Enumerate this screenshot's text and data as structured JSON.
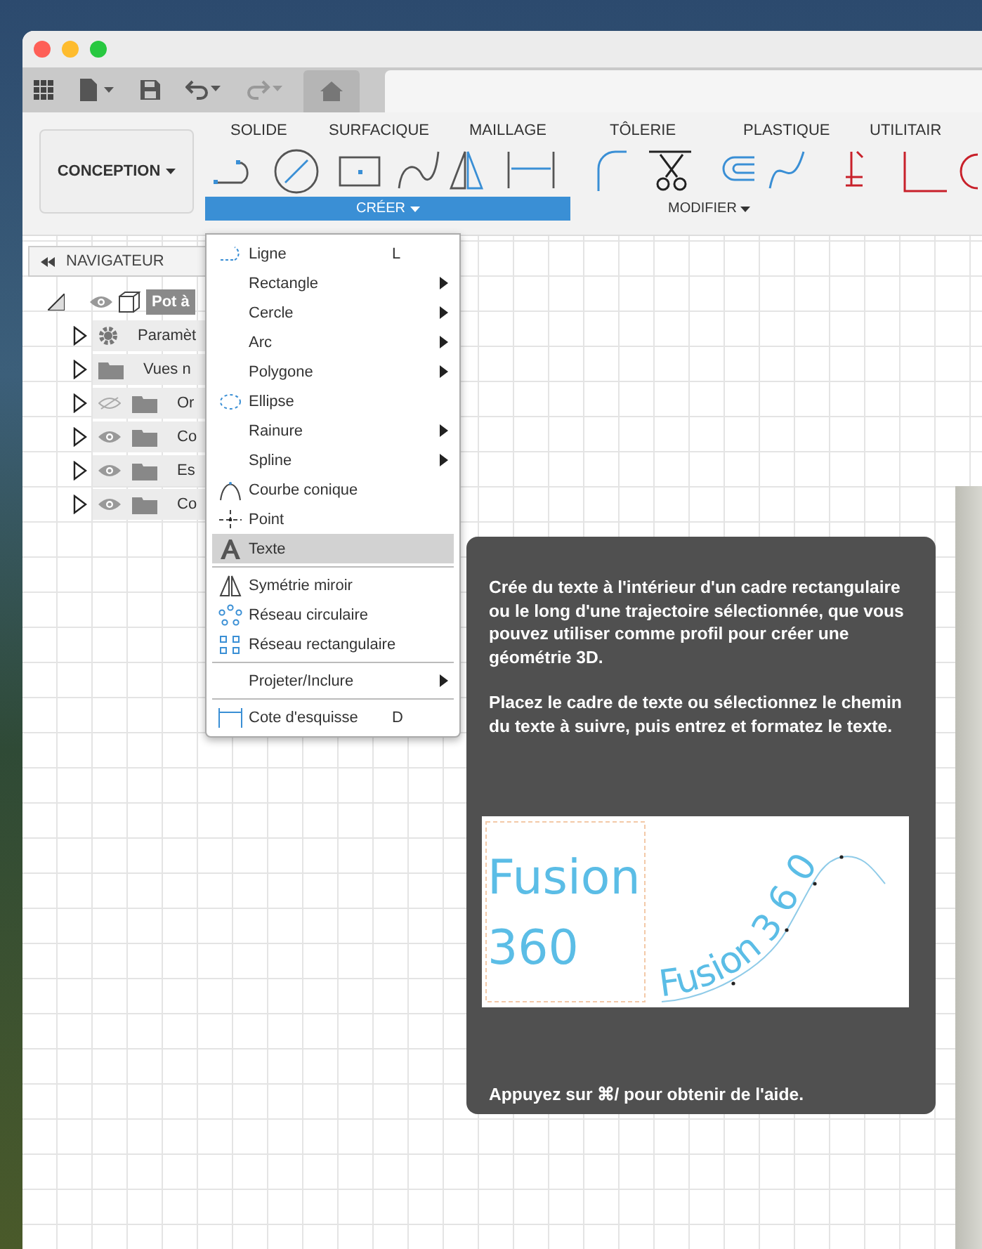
{
  "ribbon": {
    "workspace": "CONCEPTION",
    "tabs": [
      "SOLIDE",
      "SURFACIQUE",
      "MAILLAGE",
      "TÔLERIE",
      "PLASTIQUE",
      "UTILITAIR"
    ],
    "groups": [
      {
        "label": "CRÉER",
        "open": true
      },
      {
        "label": "MODIFIER",
        "open": false
      }
    ]
  },
  "navigator": {
    "title": "NAVIGATEUR",
    "root": {
      "label": "Pot à",
      "visible": true,
      "selected": true,
      "children": [
        {
          "kind": "settings",
          "label": "Paramèt",
          "selected": false
        },
        {
          "kind": "folder",
          "label": "Vues n",
          "selected": false
        },
        {
          "kind": "folder",
          "label": "Or",
          "visible": false,
          "selected": false
        },
        {
          "kind": "folder",
          "label": "Co",
          "visible": true,
          "selected": false
        },
        {
          "kind": "folder",
          "label": "Es",
          "visible": true,
          "selected": false
        },
        {
          "kind": "folder",
          "label": "Co",
          "visible": true,
          "selected": false
        }
      ]
    }
  },
  "menu": [
    {
      "label": "Ligne",
      "kind": "line",
      "shortcut": "L",
      "submenu": false,
      "selected": false,
      "divider_before": false
    },
    {
      "label": "Rectangle",
      "submenu": true,
      "selected": false,
      "divider_before": false
    },
    {
      "label": "Cercle",
      "submenu": true,
      "selected": false,
      "divider_before": false
    },
    {
      "label": "Arc",
      "submenu": true,
      "selected": false,
      "divider_before": false
    },
    {
      "label": "Polygone",
      "submenu": true,
      "selected": false,
      "divider_before": false
    },
    {
      "label": "Ellipse",
      "kind": "ellipse",
      "submenu": false,
      "selected": false,
      "divider_before": false
    },
    {
      "label": "Rainure",
      "submenu": true,
      "selected": false,
      "divider_before": false
    },
    {
      "label": "Spline",
      "submenu": true,
      "selected": false,
      "divider_before": false
    },
    {
      "label": "Courbe conique",
      "kind": "conic",
      "submenu": false,
      "selected": false,
      "divider_before": false
    },
    {
      "label": "Point",
      "kind": "point",
      "submenu": false,
      "selected": false,
      "divider_before": false
    },
    {
      "label": "Texte",
      "kind": "text",
      "submenu": false,
      "selected": true,
      "divider_before": false
    },
    {
      "label": "Symétrie miroir",
      "kind": "mirror",
      "submenu": false,
      "selected": false,
      "divider_before": true
    },
    {
      "label": "Réseau circulaire",
      "kind": "circular",
      "submenu": false,
      "selected": false,
      "divider_before": false
    },
    {
      "label": "Réseau rectangulaire",
      "kind": "rectangular",
      "submenu": false,
      "selected": false,
      "divider_before": false
    },
    {
      "label": "Projeter/Inclure",
      "submenu": true,
      "selected": false,
      "divider_before": true
    },
    {
      "label": "Cote d'esquisse",
      "kind": "dimension",
      "shortcut": "D",
      "submenu": false,
      "selected": false,
      "divider_before": true
    }
  ],
  "tooltip": {
    "paragraphs": [
      "Crée du texte à l'intérieur d'un cadre rectangulaire ou le long d'une trajectoire sélectionnée, que vous pouvez utiliser comme profil pour créer une géométrie 3D.",
      "Placez le cadre de texte ou sélectionnez le chemin du texte à suivre, puis entrez et formatez le texte."
    ],
    "illustration": {
      "box_lines": [
        "Fusion",
        "360"
      ],
      "path_text": "Fusion 3 6 0"
    },
    "help": "Appuyez sur ⌘/ pour obtenir de l'aide."
  }
}
